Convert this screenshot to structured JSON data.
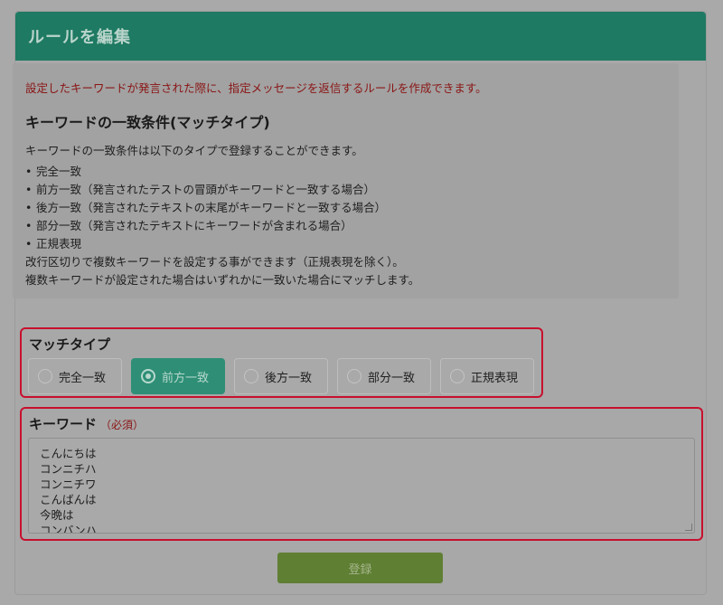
{
  "header": {
    "title": "ルールを編集"
  },
  "info": {
    "alert": "設定したキーワードが発言された際に、指定メッセージを返信するルールを作成できます。",
    "heading": "キーワードの一致条件(マッチタイプ)",
    "intro": "キーワードの一致条件は以下のタイプで登録することができます。",
    "items": [
      "完全一致",
      "前方一致（発言されたテストの冒頭がキーワードと一致する場合）",
      "後方一致（発言されたテキストの末尾がキーワードと一致する場合）",
      "部分一致（発言されたテキストにキーワードが含まれる場合）",
      "正規表現"
    ],
    "note1": "改行区切りで複数キーワードを設定する事ができます（正規表現を除く）。",
    "note2": "複数キーワードが設定された場合はいずれかに一致いた場合にマッチします。"
  },
  "match_type": {
    "title": "マッチタイプ",
    "selected": "前方一致",
    "options": [
      "完全一致",
      "前方一致",
      "後方一致",
      "部分一致",
      "正規表現"
    ]
  },
  "keyword": {
    "title": "キーワード",
    "required": "（必須）",
    "lines": [
      "こんにちは",
      "コンニチハ",
      "コンニチワ",
      "こんばんは",
      "今晩は",
      "コンバンハ"
    ]
  },
  "submit": {
    "label": "登録"
  },
  "colors": {
    "header": "#1e7a62",
    "selected": "#2e8f76",
    "submit": "#5f7f33",
    "alert": "#c8102e"
  }
}
